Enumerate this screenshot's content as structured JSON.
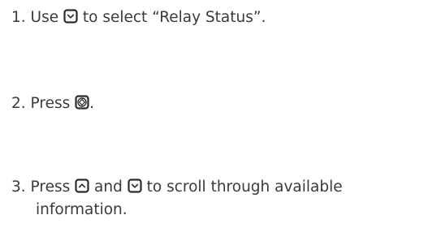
{
  "steps": [
    {
      "number": "1.",
      "before": "Use",
      "icon1": "down-arrow-key-icon",
      "after": "to select “Relay Status”."
    },
    {
      "number": "2.",
      "before": "Press",
      "icon1": "enter-key-icon",
      "after": "."
    },
    {
      "number": "3.",
      "before": "Press",
      "icon1": "up-arrow-key-icon",
      "middle": "and",
      "icon2": "down-arrow-key-icon",
      "after": "to scroll through available",
      "continuation": "information."
    }
  ]
}
